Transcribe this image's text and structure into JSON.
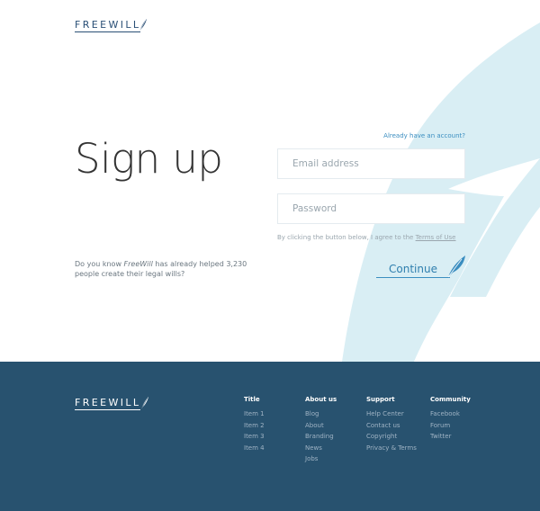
{
  "brand": {
    "logo_text": "FREEWILL",
    "feather_icon": "feather-icon",
    "accent_color": "#3b8ec0",
    "footer_color": "#28526f"
  },
  "signup": {
    "title": "Sign up",
    "already_account": "Already have an account?",
    "email_placeholder": "Email address",
    "password_placeholder": "Password",
    "terms_prefix": "By clicking the button below, I agree to the ",
    "terms_link": "Terms of Use",
    "info_prefix": "Do you know ",
    "info_brand": "FreeWill",
    "info_suffix": " has already helped 3,230 people create their legal wills?",
    "continue_label": "Continue"
  },
  "footer": {
    "logo_text": "FREEWILL",
    "columns": [
      {
        "title": "Title",
        "items": [
          "Item 1",
          "Item 2",
          "Item 3",
          "Item 4"
        ]
      },
      {
        "title": "About us",
        "items": [
          "Blog",
          "About",
          "Branding",
          "News",
          "Jobs"
        ]
      },
      {
        "title": "Support",
        "items": [
          "Help Center",
          "Contact us",
          "Copyright",
          "Privacy & Terms"
        ]
      },
      {
        "title": "Community",
        "items": [
          "Facebook",
          "Forum",
          "Twitter"
        ]
      }
    ]
  }
}
